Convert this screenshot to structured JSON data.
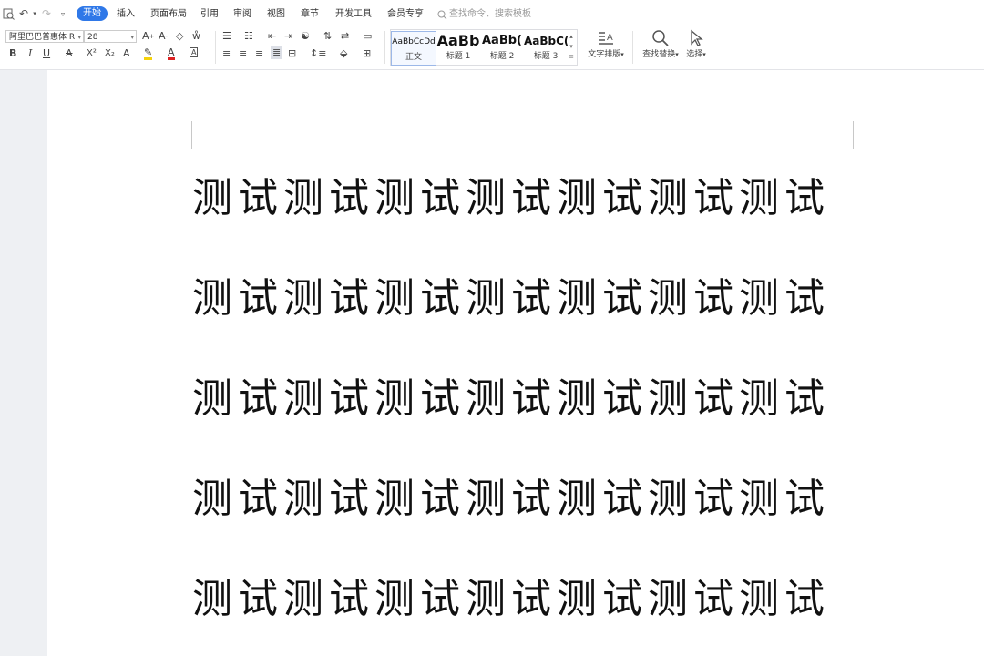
{
  "menubar": {
    "tabs": [
      "开始",
      "插入",
      "页面布局",
      "引用",
      "审阅",
      "视图",
      "章节",
      "开发工具",
      "会员专享"
    ],
    "search_placeholder": "查找命令、搜索模板"
  },
  "toolbar": {
    "font_name": "阿里巴巴普惠体 R",
    "font_size": "28",
    "styles": [
      {
        "sample": "AaBbCcDd",
        "label": "正文"
      },
      {
        "sample": "AaBb",
        "label": "标题 1"
      },
      {
        "sample": "AaBb(",
        "label": "标题 2"
      },
      {
        "sample": "AaBbC(",
        "label": "标题 3"
      }
    ],
    "text_layout_label": "文字排版",
    "find_replace_label": "查找替换",
    "select_label": "选择",
    "bold": "B",
    "italic": "I",
    "underline": "U",
    "strike": "A",
    "superscript": "X²",
    "subscript": "X₂"
  },
  "document": {
    "lines": [
      "测试测试测试测试测试测试测试",
      "测试测试测试测试测试测试测试",
      "测试测试测试测试测试测试测试",
      "测试测试测试测试测试测试测试",
      "测试测试测试测试测试测试测试"
    ]
  }
}
